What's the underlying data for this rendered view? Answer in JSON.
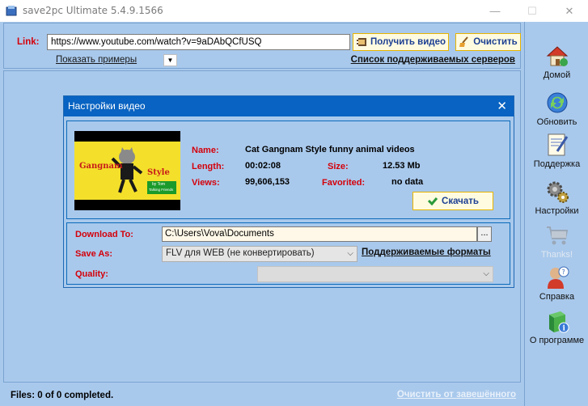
{
  "window": {
    "title": "save2pc Ultimate  5.4.9.1566",
    "minimize_icon": "—",
    "maximize_icon": "☐",
    "close_icon": "✕"
  },
  "toolbar": {
    "link_label": "Link:",
    "url_value": "https://www.youtube.com/watch?v=9aDAbQCfUSQ",
    "get_video_label": "Получить видео",
    "clear_label": "Очистить",
    "examples_label": "Показать примеры",
    "dropdown_glyph": "▼",
    "servers_label": "Список поддерживаемых серверов"
  },
  "status": {
    "files_text": "Files: 0 of 0 completed.",
    "clear_completed_label": "Очистить от завешённого"
  },
  "sidebar": {
    "items": [
      {
        "label": "Домой",
        "icon": "home-icon"
      },
      {
        "label": "Обновить",
        "icon": "refresh-icon"
      },
      {
        "label": "Поддержка",
        "icon": "support-icon"
      },
      {
        "label": "Настройки",
        "icon": "settings-icon"
      },
      {
        "label": "Thanks!",
        "icon": "cart-icon"
      },
      {
        "label": "Справка",
        "icon": "help-icon"
      },
      {
        "label": "О программе",
        "icon": "about-icon"
      }
    ]
  },
  "dialog": {
    "title": "Настройки видео",
    "close_icon": "✕",
    "thumbnail": {
      "line1": "Gangnam",
      "line2": "Style",
      "line3": "by Tom",
      "line4": "Talking Friends"
    },
    "name_label": "Name:",
    "name_value": "Cat Gangnam Style  funny animal videos",
    "length_label": "Length:",
    "length_value": "00:02:08",
    "size_label": "Size:",
    "size_value": "12.53 Mb",
    "views_label": "Views:",
    "views_value": "99,606,153",
    "favorited_label": "Favorited:",
    "favorited_value": "no data",
    "download_label": "Скачать",
    "download_to_label": "Download To:",
    "download_to_value": "C:\\Users\\Vova\\Documents",
    "browse_label": "...",
    "save_as_label": "Save As:",
    "save_as_value": "FLV для WEB (не конвертировать)",
    "formats_label": "Поддерживаемые форматы",
    "quality_label": "Quality:",
    "quality_value": ""
  },
  "colors": {
    "frame_bg": "#a9c9ec",
    "dialog_titlebar": "#0863c2",
    "label_red": "#d4000a",
    "button_text_blue": "#1c3f93",
    "button_border": "#e7b400"
  }
}
